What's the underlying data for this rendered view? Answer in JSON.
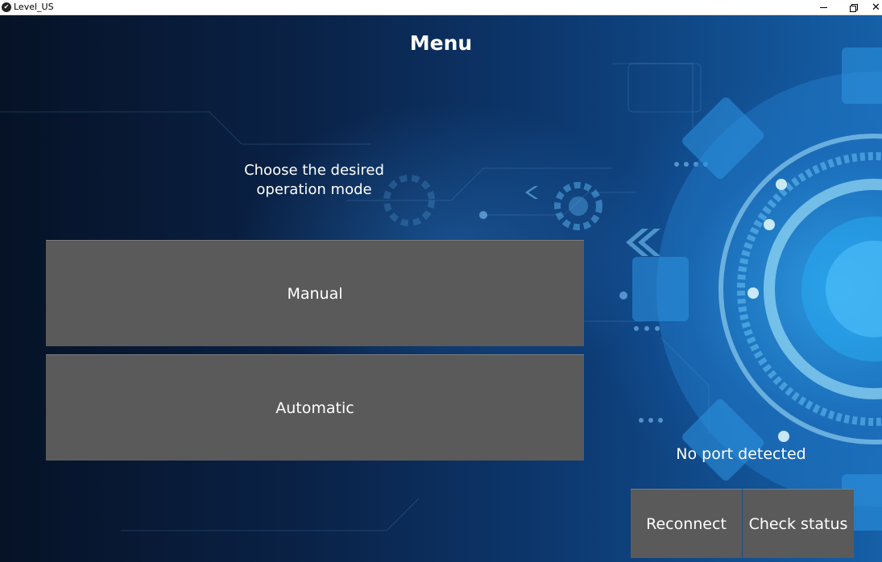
{
  "window": {
    "title": "Level_US",
    "app_icon": "app-logo-icon",
    "controls": [
      "minimize-icon",
      "restore-icon",
      "close-icon"
    ]
  },
  "menu": {
    "title": "Menu",
    "prompt": "Choose the desired\noperation mode",
    "manual_label": "Manual",
    "automatic_label": "Automatic"
  },
  "status": {
    "port_text": "No port detected"
  },
  "actions": {
    "reconnect_label": "Reconnect",
    "check_status_label": "Check status"
  },
  "colors": {
    "button_bg": "#5a5a5a",
    "text": "#ffffff",
    "background_accent": "#1e90d6"
  }
}
